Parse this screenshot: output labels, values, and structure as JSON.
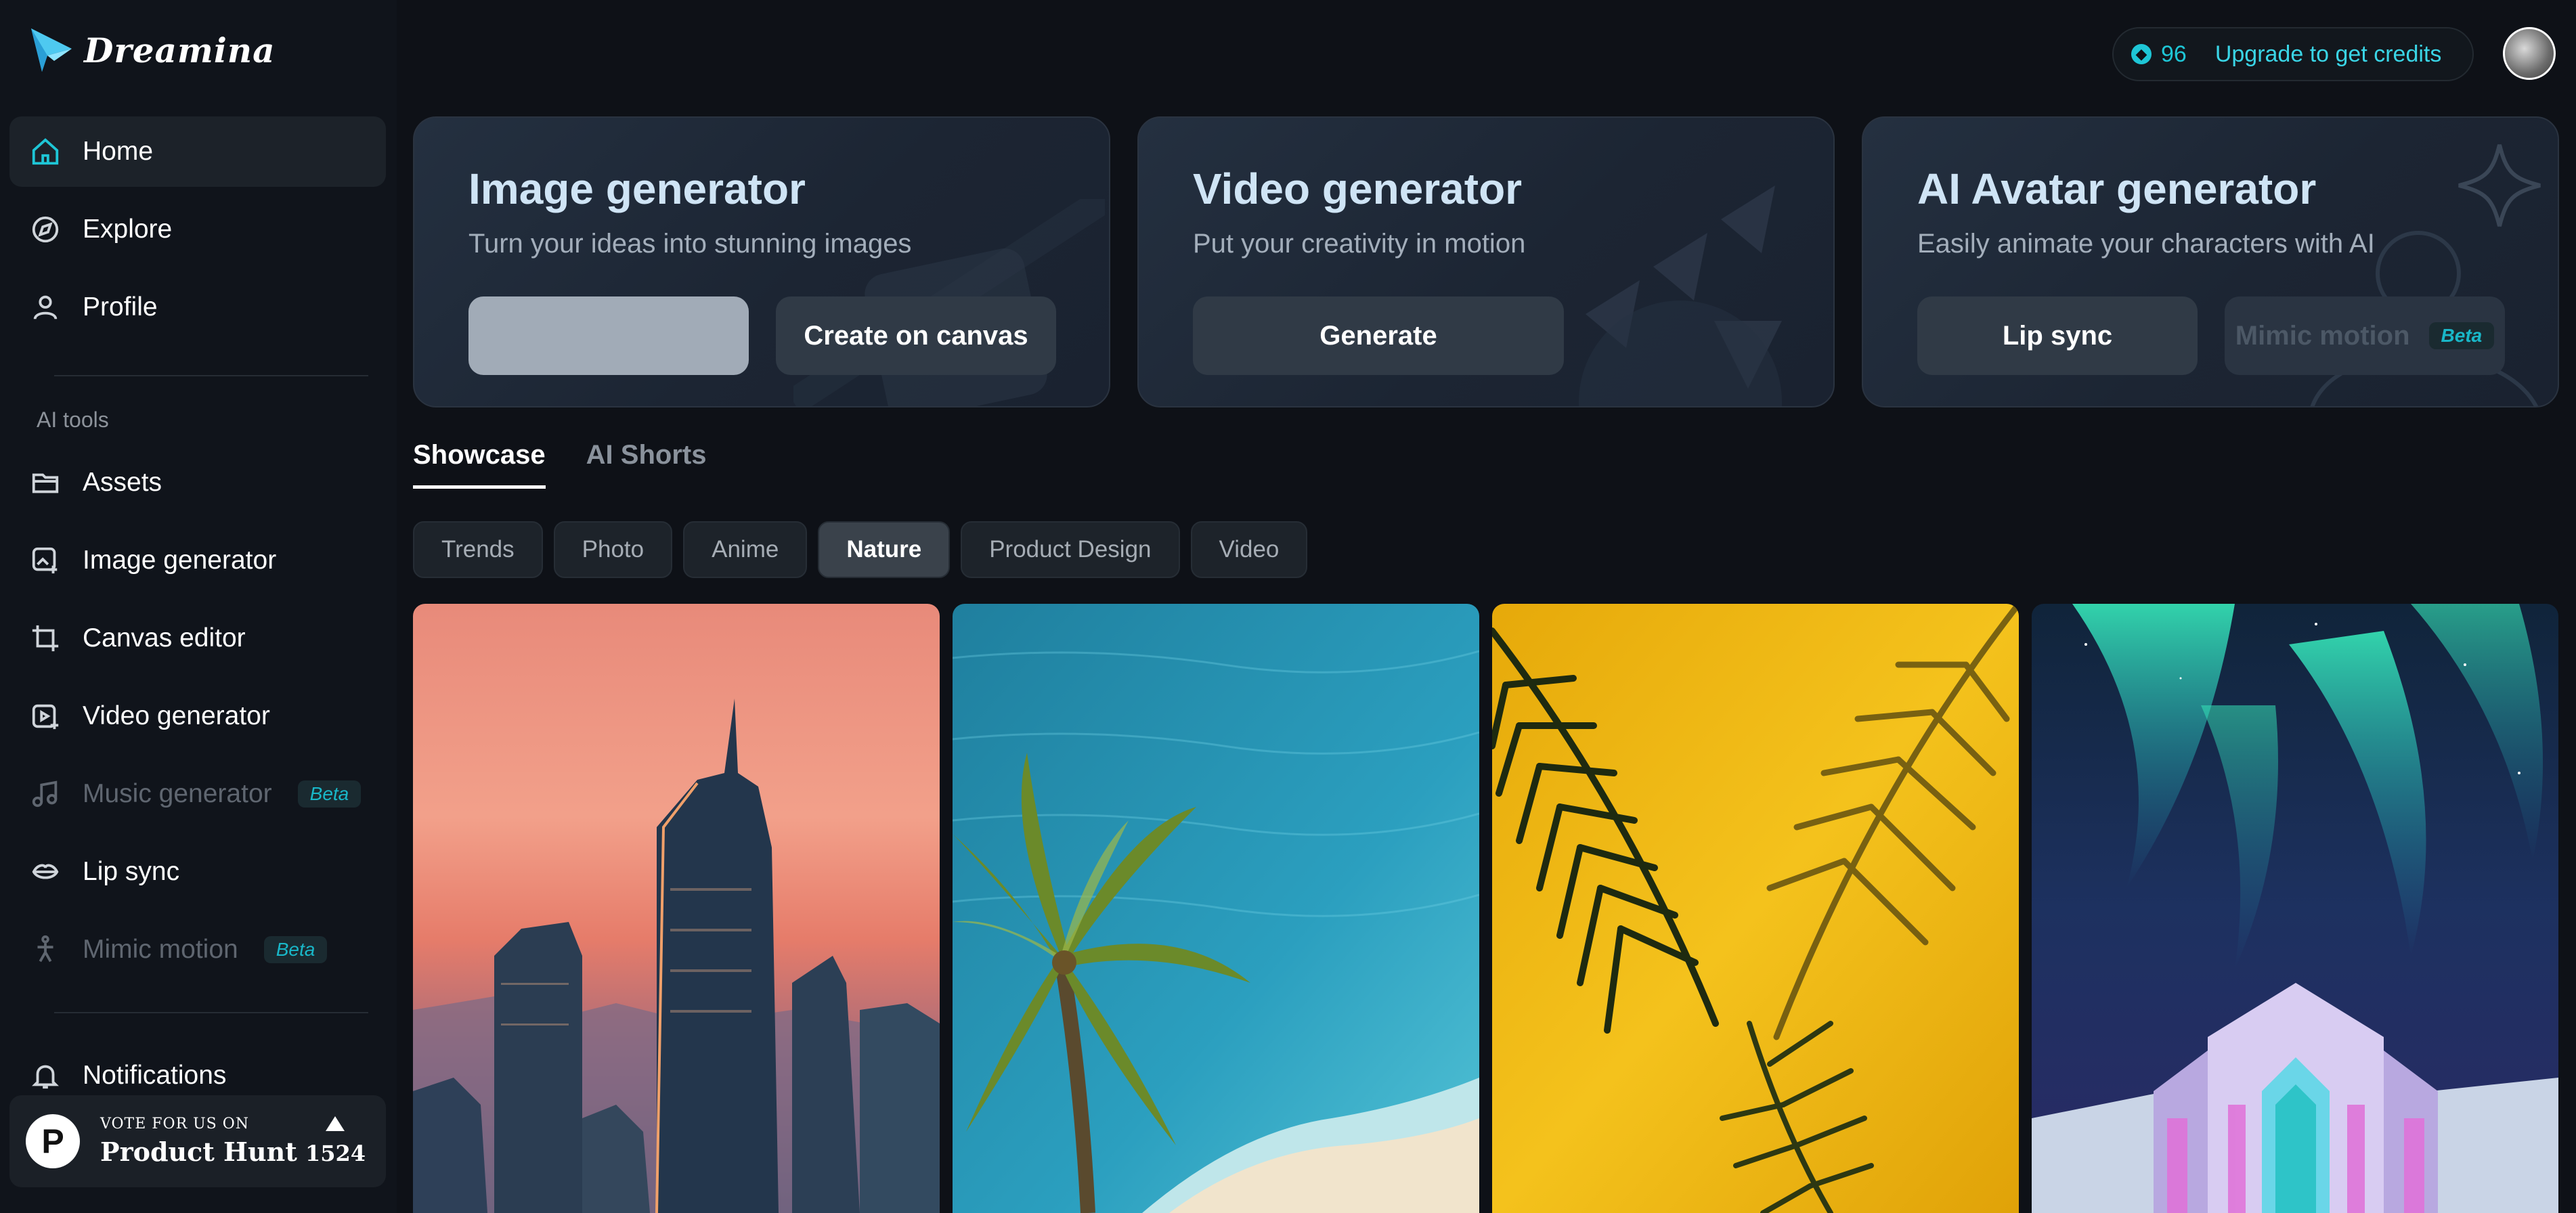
{
  "app": {
    "name": "Dreamina"
  },
  "sidebar": {
    "main": [
      {
        "label": "Home",
        "icon": "home-icon",
        "active": true
      },
      {
        "label": "Explore",
        "icon": "compass-icon"
      },
      {
        "label": "Profile",
        "icon": "user-icon"
      }
    ],
    "tools_label": "AI tools",
    "tools": [
      {
        "label": "Assets",
        "icon": "folder-icon"
      },
      {
        "label": "Image generator",
        "icon": "image-gen-icon"
      },
      {
        "label": "Canvas editor",
        "icon": "crop-icon"
      },
      {
        "label": "Video generator",
        "icon": "video-gen-icon"
      },
      {
        "label": "Music generator",
        "icon": "music-icon",
        "disabled": true,
        "badge": "Beta"
      },
      {
        "label": "Lip sync",
        "icon": "lip-sync-icon"
      },
      {
        "label": "Mimic motion",
        "icon": "mimic-motion-icon",
        "disabled": true,
        "badge": "Beta"
      }
    ],
    "notifications": {
      "label": "Notifications",
      "icon": "bell-icon"
    },
    "product_hunt": {
      "vote_text": "VOTE FOR US ON",
      "name": "Product Hunt",
      "logo_letter": "P",
      "count": "1524"
    }
  },
  "topbar": {
    "credits": "96",
    "upgrade_link": "Upgrade to get credits"
  },
  "generators": [
    {
      "title": "Image generator",
      "subtitle": "Turn your ideas into stunning images",
      "buttons": [
        {
          "label": ""
        },
        {
          "label": "Create on canvas"
        }
      ]
    },
    {
      "title": "Video generator",
      "subtitle": "Put your creativity in motion",
      "buttons": [
        {
          "label": "Generate"
        }
      ]
    },
    {
      "title": "AI Avatar generator",
      "subtitle": "Easily animate your characters with AI",
      "buttons": [
        {
          "label": "Lip sync"
        },
        {
          "label": "Mimic motion",
          "badge": "Beta",
          "disabled": true
        }
      ]
    }
  ],
  "tabs": [
    {
      "label": "Showcase",
      "active": true
    },
    {
      "label": "AI Shorts"
    }
  ],
  "chips": [
    {
      "label": "Trends"
    },
    {
      "label": "Photo"
    },
    {
      "label": "Anime"
    },
    {
      "label": "Nature",
      "active": true
    },
    {
      "label": "Product Design"
    },
    {
      "label": "Video"
    }
  ],
  "gallery": [
    {
      "subject": "city skyline at sunset"
    },
    {
      "subject": "palm tree over ocean beach"
    },
    {
      "subject": "palm leaf shadow on yellow wall"
    },
    {
      "subject": "aurora over ice palace"
    }
  ],
  "colors": {
    "background": "#0e1117",
    "accent": "#1ec6d6",
    "card": "#1c2533",
    "beta_text": "#19b7c8"
  }
}
